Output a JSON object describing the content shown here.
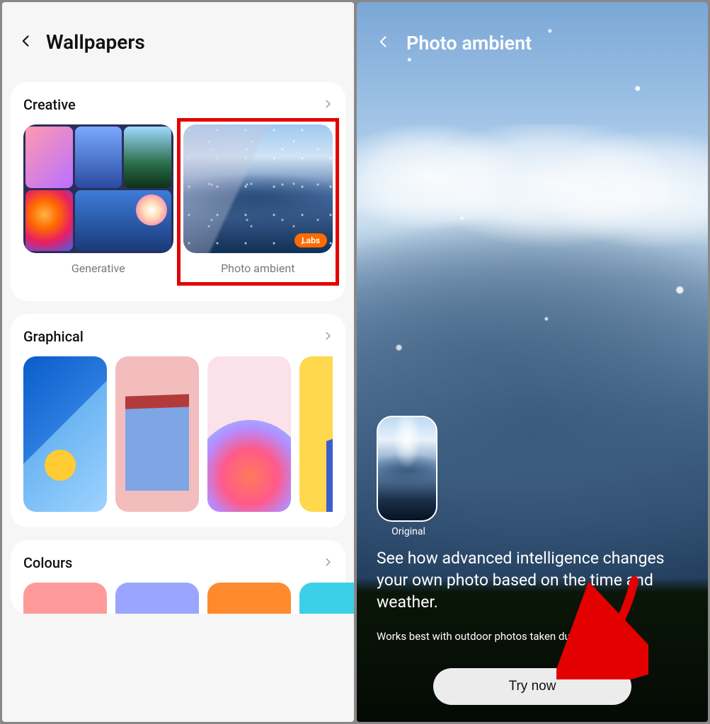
{
  "left": {
    "title": "Wallpapers",
    "sections": {
      "creative": {
        "title": "Creative",
        "items": [
          {
            "label": "Generative"
          },
          {
            "label": "Photo ambient",
            "badge": "Labs",
            "highlighted": true
          }
        ]
      },
      "graphical": {
        "title": "Graphical"
      },
      "colours": {
        "title": "Colours"
      }
    }
  },
  "right": {
    "title": "Photo ambient",
    "original_label": "Original",
    "headline": "See how advanced intelligence changes your own photo based on the time and weather.",
    "subtext": "Works best with outdoor photos taken during the day.",
    "cta": "Try now"
  }
}
